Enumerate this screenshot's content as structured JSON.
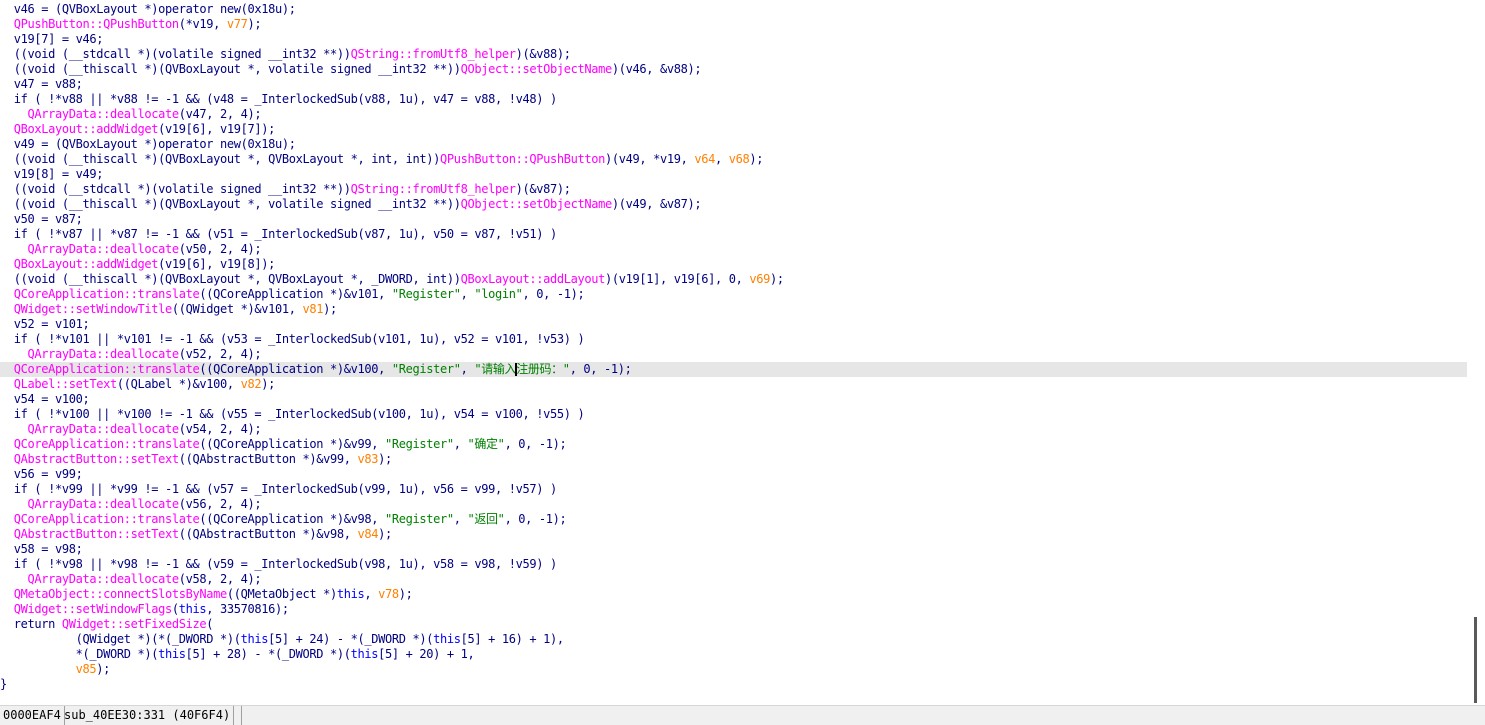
{
  "code_lines": [
    [
      [
        "  v46 = (QVBoxLayout *)",
        "v"
      ],
      [
        "operator new(0x18u);",
        "k"
      ]
    ],
    [
      [
        "  ",
        "k"
      ],
      [
        "QPushButton::QPushButton",
        "f"
      ],
      [
        "(*v19, ",
        "k"
      ],
      [
        "v77",
        "o"
      ],
      [
        ");",
        "k"
      ]
    ],
    [
      [
        "  v19[7] = v46;",
        "v"
      ]
    ],
    [
      [
        "  ((void (__stdcall *)(volatile signed __int32 **))",
        "k"
      ],
      [
        "QString::fromUtf8_helper",
        "f"
      ],
      [
        ")(&",
        "k"
      ],
      [
        "v88",
        "v"
      ],
      [
        ");",
        "k"
      ]
    ],
    [
      [
        "  ((void (__thiscall *)(QVBoxLayout *, volatile signed __int32 **))",
        "k"
      ],
      [
        "QObject::setObjectName",
        "f"
      ],
      [
        ")(v46, &",
        "k"
      ],
      [
        "v88",
        "v"
      ],
      [
        ");",
        "k"
      ]
    ],
    [
      [
        "  v47 = v88;",
        "v"
      ]
    ],
    [
      [
        "  if ( !*",
        "k"
      ],
      [
        "v88",
        "v"
      ],
      [
        " || *",
        "k"
      ],
      [
        "v88",
        "v"
      ],
      [
        " != -1 && (",
        "k"
      ],
      [
        "v48",
        "v"
      ],
      [
        " = _InterlockedSub(",
        "k"
      ],
      [
        "v88",
        "v"
      ],
      [
        ", 1u), ",
        "k"
      ],
      [
        "v47",
        "v"
      ],
      [
        " = ",
        "k"
      ],
      [
        "v88",
        "v"
      ],
      [
        ", !",
        "k"
      ],
      [
        "v48",
        "v"
      ],
      [
        ") )",
        "k"
      ]
    ],
    [
      [
        "    ",
        "k"
      ],
      [
        "QArrayData::deallocate",
        "f"
      ],
      [
        "(",
        "k"
      ],
      [
        "v47",
        "v"
      ],
      [
        ", 2, 4);",
        "k"
      ]
    ],
    [
      [
        "  ",
        "k"
      ],
      [
        "QBoxLayout::addWidget",
        "f"
      ],
      [
        "(v19[6], v19[7]);",
        "k"
      ]
    ],
    [
      [
        "  v49 = (QVBoxLayout *)",
        "v"
      ],
      [
        "operator new(0x18u);",
        "k"
      ]
    ],
    [
      [
        "  ((void (__thiscall *)(QVBoxLayout *, QVBoxLayout *, int, int))",
        "k"
      ],
      [
        "QPushButton::QPushButton",
        "f"
      ],
      [
        ")(v49, *v19, ",
        "k"
      ],
      [
        "v64",
        "o"
      ],
      [
        ", ",
        "k"
      ],
      [
        "v68",
        "o"
      ],
      [
        ");",
        "k"
      ]
    ],
    [
      [
        "  v19[8] = v49;",
        "v"
      ]
    ],
    [
      [
        "  ((void (__stdcall *)(volatile signed __int32 **))",
        "k"
      ],
      [
        "QString::fromUtf8_helper",
        "f"
      ],
      [
        ")(&",
        "k"
      ],
      [
        "v87",
        "v"
      ],
      [
        ");",
        "k"
      ]
    ],
    [
      [
        "  ((void (__thiscall *)(QVBoxLayout *, volatile signed __int32 **))",
        "k"
      ],
      [
        "QObject::setObjectName",
        "f"
      ],
      [
        ")(v49, &",
        "k"
      ],
      [
        "v87",
        "v"
      ],
      [
        ");",
        "k"
      ]
    ],
    [
      [
        "  v50 = v87;",
        "v"
      ]
    ],
    [
      [
        "  if ( !*",
        "k"
      ],
      [
        "v87",
        "v"
      ],
      [
        " || *",
        "k"
      ],
      [
        "v87",
        "v"
      ],
      [
        " != -1 && (",
        "k"
      ],
      [
        "v51",
        "v"
      ],
      [
        " = _InterlockedSub(",
        "k"
      ],
      [
        "v87",
        "v"
      ],
      [
        ", 1u), ",
        "k"
      ],
      [
        "v50",
        "v"
      ],
      [
        " = ",
        "k"
      ],
      [
        "v87",
        "v"
      ],
      [
        ", !",
        "k"
      ],
      [
        "v51",
        "v"
      ],
      [
        ") )",
        "k"
      ]
    ],
    [
      [
        "    ",
        "k"
      ],
      [
        "QArrayData::deallocate",
        "f"
      ],
      [
        "(",
        "k"
      ],
      [
        "v50",
        "v"
      ],
      [
        ", 2, 4);",
        "k"
      ]
    ],
    [
      [
        "  ",
        "k"
      ],
      [
        "QBoxLayout::addWidget",
        "f"
      ],
      [
        "(v19[6], v19[8]);",
        "k"
      ]
    ],
    [
      [
        "  ((void (__thiscall *)(QVBoxLayout *, QVBoxLayout *, _DWORD, int))",
        "k"
      ],
      [
        "QBoxLayout::addLayout",
        "f"
      ],
      [
        ")(v19[1], v19[6], 0, ",
        "k"
      ],
      [
        "v69",
        "o"
      ],
      [
        ");",
        "k"
      ]
    ],
    [
      [
        "  ",
        "k"
      ],
      [
        "QCoreApplication::translate",
        "f"
      ],
      [
        "((QCoreApplication *)&",
        "k"
      ],
      [
        "v101",
        "v"
      ],
      [
        ", ",
        "k"
      ],
      [
        "\"Register\"",
        "s"
      ],
      [
        ", ",
        "k"
      ],
      [
        "\"login\"",
        "s"
      ],
      [
        ", 0, -1);",
        "k"
      ]
    ],
    [
      [
        "  ",
        "k"
      ],
      [
        "QWidget::setWindowTitle",
        "f"
      ],
      [
        "((QWidget *)&",
        "k"
      ],
      [
        "v101",
        "v"
      ],
      [
        ", ",
        "k"
      ],
      [
        "v81",
        "o"
      ],
      [
        ");",
        "k"
      ]
    ],
    [
      [
        "  v52 = v101;",
        "v"
      ]
    ],
    [
      [
        "  if ( !*",
        "k"
      ],
      [
        "v101",
        "v"
      ],
      [
        " || *",
        "k"
      ],
      [
        "v101",
        "v"
      ],
      [
        " != -1 && (",
        "k"
      ],
      [
        "v53",
        "v"
      ],
      [
        " = _InterlockedSub(",
        "k"
      ],
      [
        "v101",
        "v"
      ],
      [
        ", 1u), ",
        "k"
      ],
      [
        "v52",
        "v"
      ],
      [
        " = ",
        "k"
      ],
      [
        "v101",
        "v"
      ],
      [
        ", !",
        "k"
      ],
      [
        "v53",
        "v"
      ],
      [
        ") )",
        "k"
      ]
    ],
    [
      [
        "    ",
        "k"
      ],
      [
        "QArrayData::deallocate",
        "f"
      ],
      [
        "(",
        "k"
      ],
      [
        "v52",
        "v"
      ],
      [
        ", 2, 4);",
        "k"
      ]
    ],
    [
      [
        "  ",
        "k"
      ],
      [
        "QCoreApplication::translate",
        "f"
      ],
      [
        "((QCoreApplication *)&",
        "k"
      ],
      [
        "v100",
        "v"
      ],
      [
        ", ",
        "k"
      ],
      [
        "\"Register\"",
        "s"
      ],
      [
        ", ",
        "k"
      ],
      [
        "\"请输入注册码：\"",
        "s"
      ],
      [
        ", 0, -1);",
        "k"
      ]
    ],
    [
      [
        "  ",
        "k"
      ],
      [
        "QLabel::setText",
        "f"
      ],
      [
        "((QLabel *)&",
        "k"
      ],
      [
        "v100",
        "v"
      ],
      [
        ", ",
        "k"
      ],
      [
        "v82",
        "o"
      ],
      [
        ");",
        "k"
      ]
    ],
    [
      [
        "  v54 = v100;",
        "v"
      ]
    ],
    [
      [
        "  if ( !*",
        "k"
      ],
      [
        "v100",
        "v"
      ],
      [
        " || *",
        "k"
      ],
      [
        "v100",
        "v"
      ],
      [
        " != -1 && (",
        "k"
      ],
      [
        "v55",
        "v"
      ],
      [
        " = _InterlockedSub(",
        "k"
      ],
      [
        "v100",
        "v"
      ],
      [
        ", 1u), ",
        "k"
      ],
      [
        "v54",
        "v"
      ],
      [
        " = ",
        "k"
      ],
      [
        "v100",
        "v"
      ],
      [
        ", !",
        "k"
      ],
      [
        "v55",
        "v"
      ],
      [
        ") )",
        "k"
      ]
    ],
    [
      [
        "    ",
        "k"
      ],
      [
        "QArrayData::deallocate",
        "f"
      ],
      [
        "(",
        "k"
      ],
      [
        "v54",
        "v"
      ],
      [
        ", 2, 4);",
        "k"
      ]
    ],
    [
      [
        "  ",
        "k"
      ],
      [
        "QCoreApplication::translate",
        "f"
      ],
      [
        "((QCoreApplication *)&",
        "k"
      ],
      [
        "v99",
        "v"
      ],
      [
        ", ",
        "k"
      ],
      [
        "\"Register\"",
        "s"
      ],
      [
        ", ",
        "k"
      ],
      [
        "\"确定\"",
        "s"
      ],
      [
        ", 0, -1);",
        "k"
      ]
    ],
    [
      [
        "  ",
        "k"
      ],
      [
        "QAbstractButton::setText",
        "f"
      ],
      [
        "((QAbstractButton *)&",
        "k"
      ],
      [
        "v99",
        "v"
      ],
      [
        ", ",
        "k"
      ],
      [
        "v83",
        "o"
      ],
      [
        ");",
        "k"
      ]
    ],
    [
      [
        "  v56 = v99;",
        "v"
      ]
    ],
    [
      [
        "  if ( !*",
        "k"
      ],
      [
        "v99",
        "v"
      ],
      [
        " || *",
        "k"
      ],
      [
        "v99",
        "v"
      ],
      [
        " != -1 && (",
        "k"
      ],
      [
        "v57",
        "v"
      ],
      [
        " = _InterlockedSub(",
        "k"
      ],
      [
        "v99",
        "v"
      ],
      [
        ", 1u), ",
        "k"
      ],
      [
        "v56",
        "v"
      ],
      [
        " = ",
        "k"
      ],
      [
        "v99",
        "v"
      ],
      [
        ", !",
        "k"
      ],
      [
        "v57",
        "v"
      ],
      [
        ") )",
        "k"
      ]
    ],
    [
      [
        "    ",
        "k"
      ],
      [
        "QArrayData::deallocate",
        "f"
      ],
      [
        "(",
        "k"
      ],
      [
        "v56",
        "v"
      ],
      [
        ", 2, 4);",
        "k"
      ]
    ],
    [
      [
        "  ",
        "k"
      ],
      [
        "QCoreApplication::translate",
        "f"
      ],
      [
        "((QCoreApplication *)&",
        "k"
      ],
      [
        "v98",
        "v"
      ],
      [
        ", ",
        "k"
      ],
      [
        "\"Register\"",
        "s"
      ],
      [
        ", ",
        "k"
      ],
      [
        "\"返回\"",
        "s"
      ],
      [
        ", 0, -1);",
        "k"
      ]
    ],
    [
      [
        "  ",
        "k"
      ],
      [
        "QAbstractButton::setText",
        "f"
      ],
      [
        "((QAbstractButton *)&",
        "k"
      ],
      [
        "v98",
        "v"
      ],
      [
        ", ",
        "k"
      ],
      [
        "v84",
        "o"
      ],
      [
        ");",
        "k"
      ]
    ],
    [
      [
        "  v58 = v98;",
        "v"
      ]
    ],
    [
      [
        "  if ( !*",
        "k"
      ],
      [
        "v98",
        "v"
      ],
      [
        " || *",
        "k"
      ],
      [
        "v98",
        "v"
      ],
      [
        " != -1 && (",
        "k"
      ],
      [
        "v59",
        "v"
      ],
      [
        " = _InterlockedSub(",
        "k"
      ],
      [
        "v98",
        "v"
      ],
      [
        ", 1u), ",
        "k"
      ],
      [
        "v58",
        "v"
      ],
      [
        " = ",
        "k"
      ],
      [
        "v98",
        "v"
      ],
      [
        ", !",
        "k"
      ],
      [
        "v59",
        "v"
      ],
      [
        ") )",
        "k"
      ]
    ],
    [
      [
        "    ",
        "k"
      ],
      [
        "QArrayData::deallocate",
        "f"
      ],
      [
        "(",
        "k"
      ],
      [
        "v58",
        "v"
      ],
      [
        ", 2, 4);",
        "k"
      ]
    ],
    [
      [
        "  ",
        "k"
      ],
      [
        "QMetaObject::connectSlotsByName",
        "f"
      ],
      [
        "((QMetaObject *)",
        "k"
      ],
      [
        "this",
        "r"
      ],
      [
        ", ",
        "k"
      ],
      [
        "v78",
        "o"
      ],
      [
        ");",
        "k"
      ]
    ],
    [
      [
        "  ",
        "k"
      ],
      [
        "QWidget::setWindowFlags",
        "f"
      ],
      [
        "(",
        "k"
      ],
      [
        "this",
        "r"
      ],
      [
        ", 33570816);",
        "k"
      ]
    ],
    [
      [
        "  return ",
        "k"
      ],
      [
        "QWidget::setFixedSize",
        "f"
      ],
      [
        "(",
        "k"
      ]
    ],
    [
      [
        "           (QWidget *)(*(_DWORD *)(",
        "k"
      ],
      [
        "this",
        "r"
      ],
      [
        "[5] + 24) - *(_DWORD *)(",
        "k"
      ],
      [
        "this",
        "r"
      ],
      [
        "[5] + 16) + 1),",
        "k"
      ]
    ],
    [
      [
        "           *(_DWORD *)(",
        "k"
      ],
      [
        "this",
        "r"
      ],
      [
        "[5] + 28) - *(_DWORD *)(",
        "k"
      ],
      [
        "this",
        "r"
      ],
      [
        "[5] + 20) + 1,",
        "k"
      ]
    ],
    [
      [
        "           ",
        "k"
      ],
      [
        "v85",
        "o"
      ],
      [
        ");",
        "k"
      ]
    ],
    [
      [
        "}",
        "k"
      ]
    ]
  ],
  "status": {
    "offset": "0000EAF4",
    "location": "sub_40EE30:331 (40F6F4)"
  }
}
